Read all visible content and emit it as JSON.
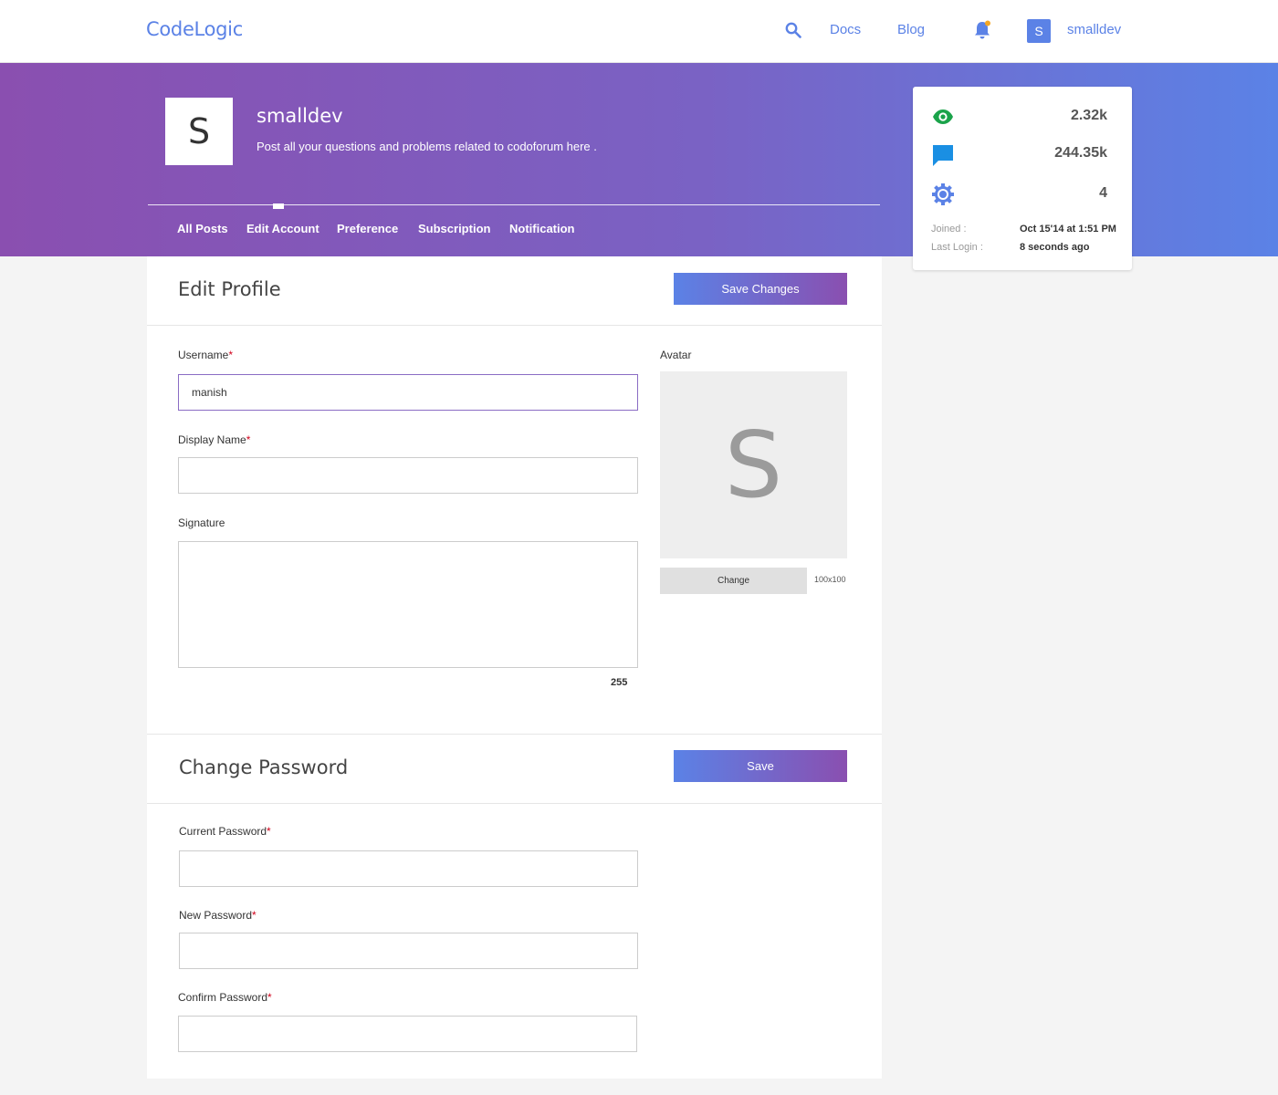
{
  "nav": {
    "logo": "CodeLogic",
    "docs": "Docs",
    "blog": "Blog",
    "avatar_letter": "S",
    "username": "smalldev",
    "brand_color": "#5b82e6",
    "notification_dot_color": "#f5a623"
  },
  "profile": {
    "letter": "S",
    "name": "smalldev",
    "description": "Post all your questions and problems related to codoforum here .",
    "tabs": [
      {
        "label": "All Posts"
      },
      {
        "label": "Edit Account",
        "active": true
      },
      {
        "label": "Preference"
      },
      {
        "label": "Subscription"
      },
      {
        "label": "Notification"
      }
    ]
  },
  "stats": {
    "views": "2.32k",
    "posts": "244.35k",
    "reputation": "4",
    "joined_label": "Joined :",
    "joined_value": "Oct 15'14 at 1:51 PM",
    "last_login_label": "Last Login :",
    "last_login_value": "8 seconds ago",
    "icon_colors": {
      "views": "#1aa34a",
      "posts": "#1a8fe3",
      "reputation": "#5b82e6"
    }
  },
  "edit_profile": {
    "title": "Edit Profile",
    "save_label": "Save Changes",
    "username_label": "Username",
    "username_value": "manish",
    "display_name_label": "Display Name",
    "display_name_value": "",
    "signature_label": "Signature",
    "signature_value": "",
    "signature_counter": "255",
    "avatar_label": "Avatar",
    "avatar_letter": "S",
    "change_label": "Change",
    "avatar_size": "100x100"
  },
  "change_password": {
    "title": "Change Password",
    "save_label": "Save",
    "current_label": "Current Password",
    "new_label": "New Password",
    "confirm_label": "Confirm Password",
    "required_mark": "*"
  }
}
